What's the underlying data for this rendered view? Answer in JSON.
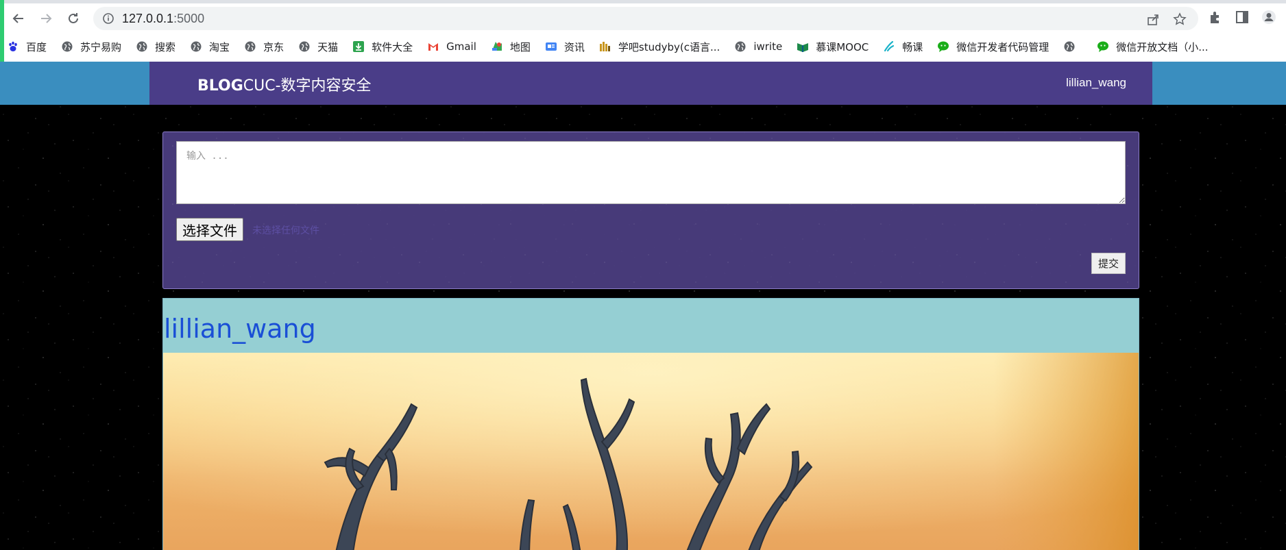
{
  "browser": {
    "url_host": "127.0.0.1",
    "url_port": ":5000",
    "bookmarks": [
      {
        "label": "百度",
        "icon": "baidu-paw-icon",
        "color": "#2932e1"
      },
      {
        "label": "苏宁易购",
        "icon": "globe-icon",
        "color": "#5f6368"
      },
      {
        "label": "搜索",
        "icon": "globe-icon",
        "color": "#5f6368"
      },
      {
        "label": "淘宝",
        "icon": "globe-icon",
        "color": "#5f6368"
      },
      {
        "label": "京东",
        "icon": "globe-icon",
        "color": "#5f6368"
      },
      {
        "label": "天猫",
        "icon": "globe-icon",
        "color": "#5f6368"
      },
      {
        "label": "软件大全",
        "icon": "download-icon",
        "color": "#2ea44f"
      },
      {
        "label": "Gmail",
        "icon": "gmail-icon",
        "color": "#ea4335"
      },
      {
        "label": "地图",
        "icon": "maps-icon",
        "color": "#34a853"
      },
      {
        "label": "资讯",
        "icon": "news-icon",
        "color": "#4285f4"
      },
      {
        "label": "学吧studyby(c语言...",
        "icon": "studyby-icon",
        "color": "#c8961e"
      },
      {
        "label": "iwrite",
        "icon": "globe-icon",
        "color": "#5f6368"
      },
      {
        "label": "慕课MOOC",
        "icon": "mooc-icon",
        "color": "#1d8a4a"
      },
      {
        "label": "畅课",
        "icon": "changke-icon",
        "color": "#1bb3c9"
      },
      {
        "label": "微信开发者代码管理",
        "icon": "wechat-icon",
        "color": "#1aad19"
      },
      {
        "label": "",
        "icon": "globe-icon",
        "color": "#5f6368"
      },
      {
        "label": "微信开放文档（小...",
        "icon": "wechat-icon",
        "color": "#1aad19"
      }
    ]
  },
  "header": {
    "brand_bold": "BLOG",
    "brand_rest": "CUC-数字内容安全",
    "user": "lillian_wang"
  },
  "form": {
    "placeholder": "输入 ...",
    "file_button": "选择文件",
    "file_status": "未选择任何文件",
    "submit": "提交"
  },
  "post": {
    "author": "lillian_wang",
    "image_description": "deer antlers against sunset"
  },
  "colors": {
    "header_bar": "#4a3d88",
    "header_side": "#3a8ebf",
    "author_bar": "#95cfd3",
    "author_link": "#1a4fd6"
  }
}
